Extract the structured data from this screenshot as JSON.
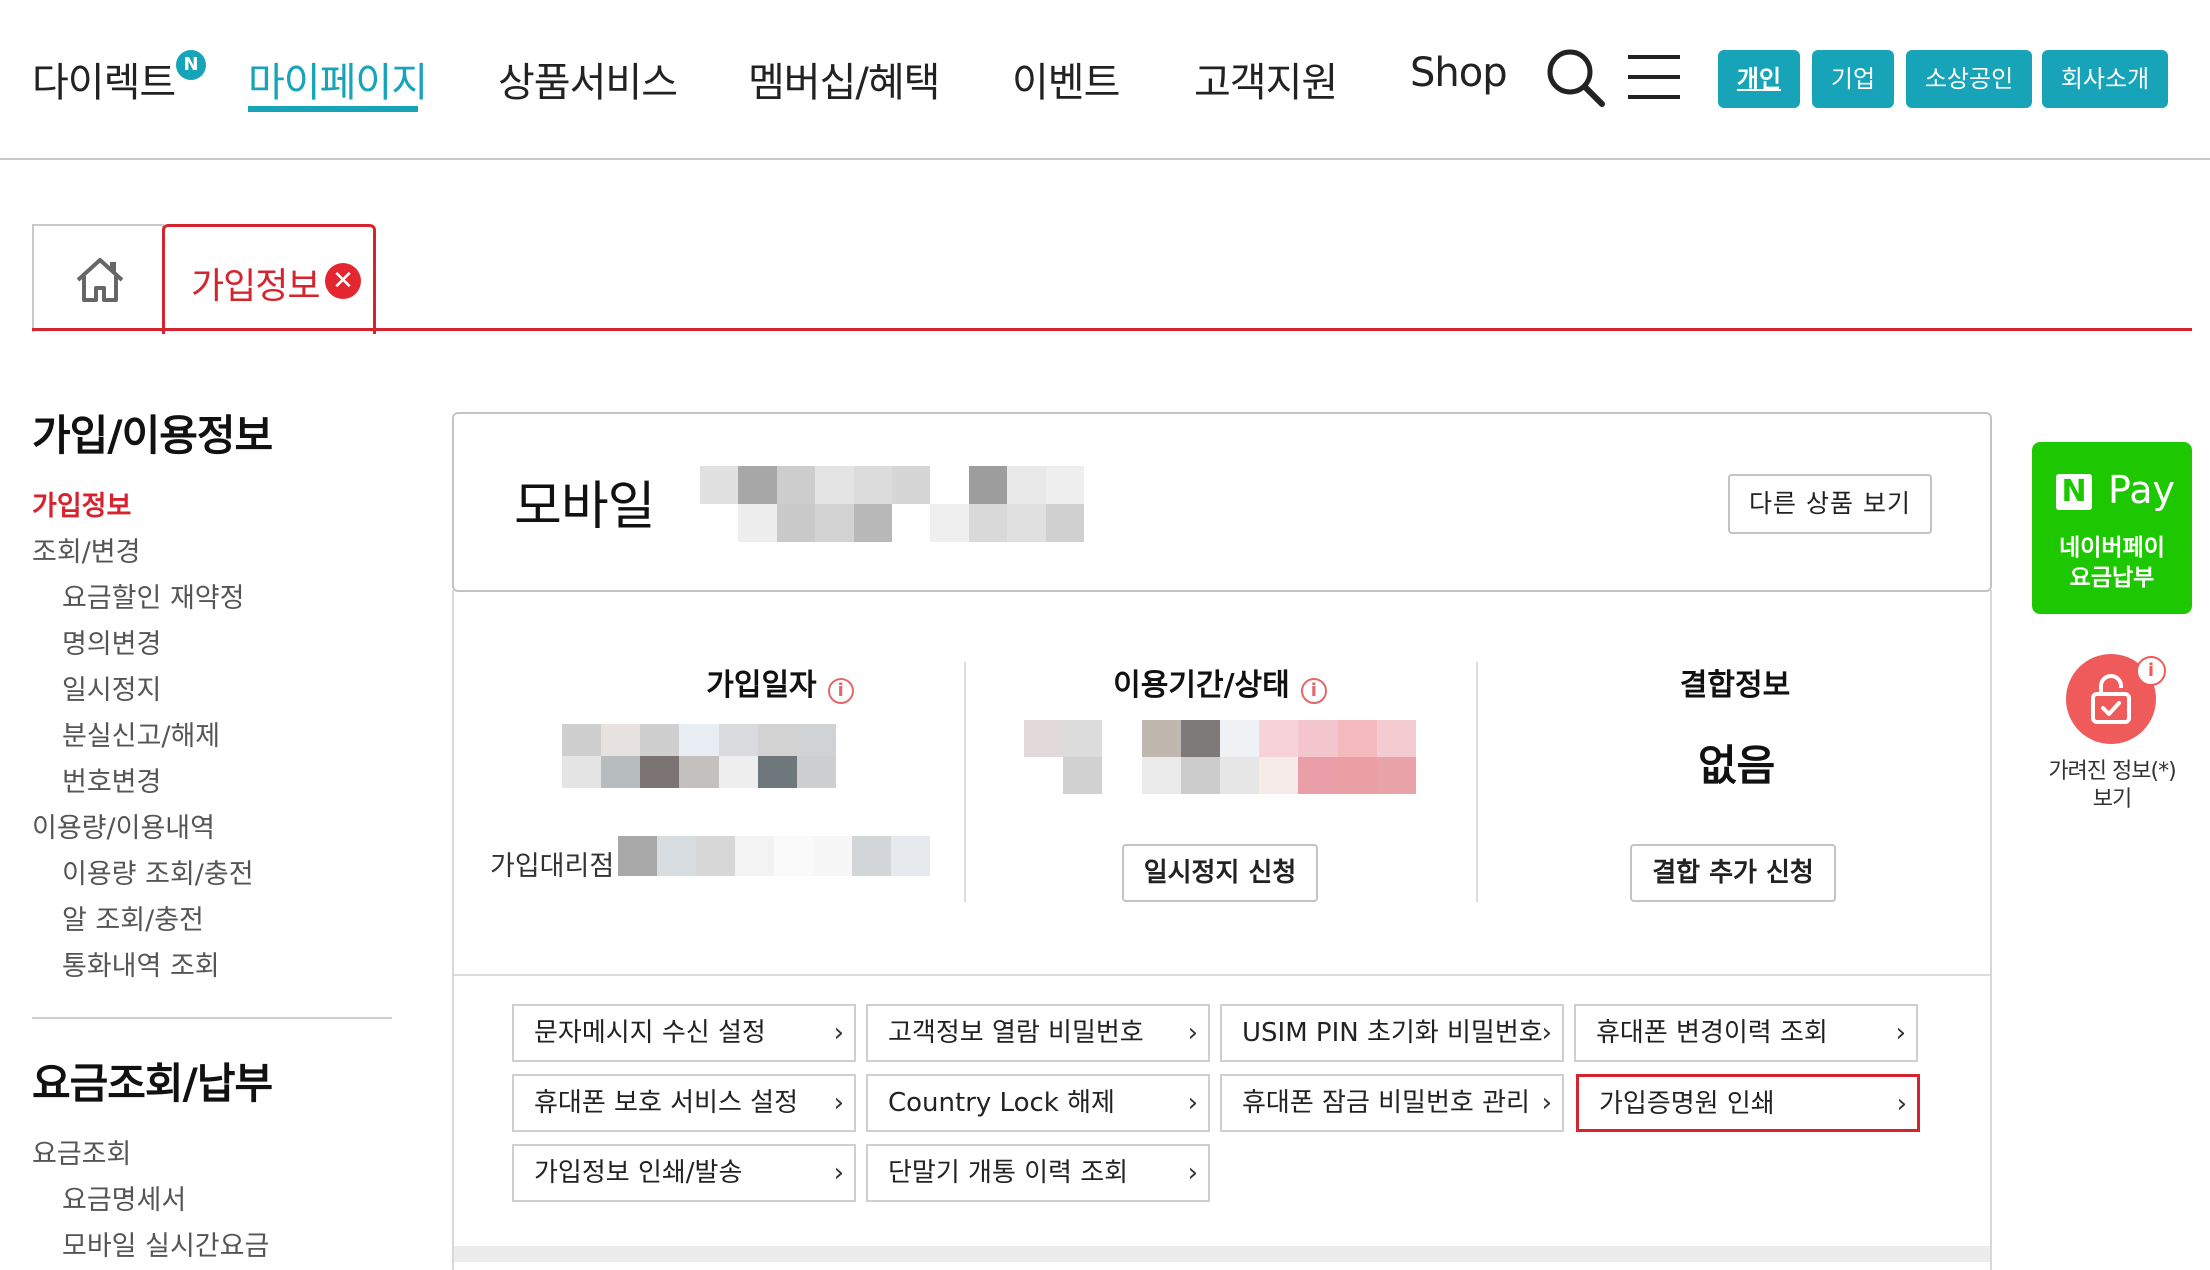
{
  "nav": {
    "direct": "다이렉트",
    "direct_badge": "N",
    "mypage": "마이페이지",
    "products": "상품서비스",
    "membership": "멤버십/혜택",
    "event": "이벤트",
    "support": "고객지원",
    "shop": "Shop",
    "segments": [
      "개인",
      "기업",
      "소상공인",
      "회사소개"
    ]
  },
  "tabs": {
    "active_label": "가입정보",
    "close_glyph": "✕"
  },
  "sidebar": {
    "section1_title": "가입/이용정보",
    "items": [
      {
        "label": "가입정보",
        "level": 1,
        "active": true
      },
      {
        "label": "조회/변경",
        "level": 1
      },
      {
        "label": "요금할인 재약정",
        "level": 2
      },
      {
        "label": "명의변경",
        "level": 2
      },
      {
        "label": "일시정지",
        "level": 2
      },
      {
        "label": "분실신고/해제",
        "level": 2
      },
      {
        "label": "번호변경",
        "level": 2
      },
      {
        "label": "이용량/이용내역",
        "level": 1
      },
      {
        "label": "이용량 조회/충전",
        "level": 2
      },
      {
        "label": "알 조회/충전",
        "level": 2
      },
      {
        "label": "통화내역 조회",
        "level": 2
      }
    ],
    "section2_title": "요금조회/납부",
    "items2": [
      {
        "label": "요금조회",
        "level": 1
      },
      {
        "label": "요금명세서",
        "level": 2
      },
      {
        "label": "모바일 실시간요금",
        "level": 2
      }
    ]
  },
  "main": {
    "title": "모바일",
    "other_product_button": "다른 상품 보기",
    "join_date_title": "가입일자",
    "usage_status_title": "이용기간/상태",
    "combo_title": "결합정보",
    "combo_value": "없음",
    "agent_label": "가입대리점",
    "suspend_button": "일시정지 신청",
    "combo_add_button": "결합 추가 신청",
    "info_glyph": "i",
    "menu_buttons": [
      "문자메시지 수신 설정",
      "고객정보 열람 비밀번호",
      "USIM PIN 초기화 비밀번호",
      "휴대폰 변경이력 조회",
      "휴대폰 보호 서비스 설정",
      "Country Lock 해제",
      "휴대폰 잠금 비밀번호 관리",
      "가입증명원 인쇄",
      "가입정보 인쇄/발송",
      "단말기 개통 이력 조회"
    ],
    "highlighted_menu": "가입증명원 인쇄"
  },
  "right": {
    "npay_n": "N",
    "npay_pay": "Pay",
    "npay_line1": "네이버페이",
    "npay_line2": "요금납부",
    "hidden_info_line1": "가려진 정보(*)",
    "hidden_info_line2": "보기",
    "info_glyph": "i"
  },
  "colors": {
    "accent": "#17a4b8",
    "red": "#d7232e",
    "npay_green": "#1ec800"
  }
}
